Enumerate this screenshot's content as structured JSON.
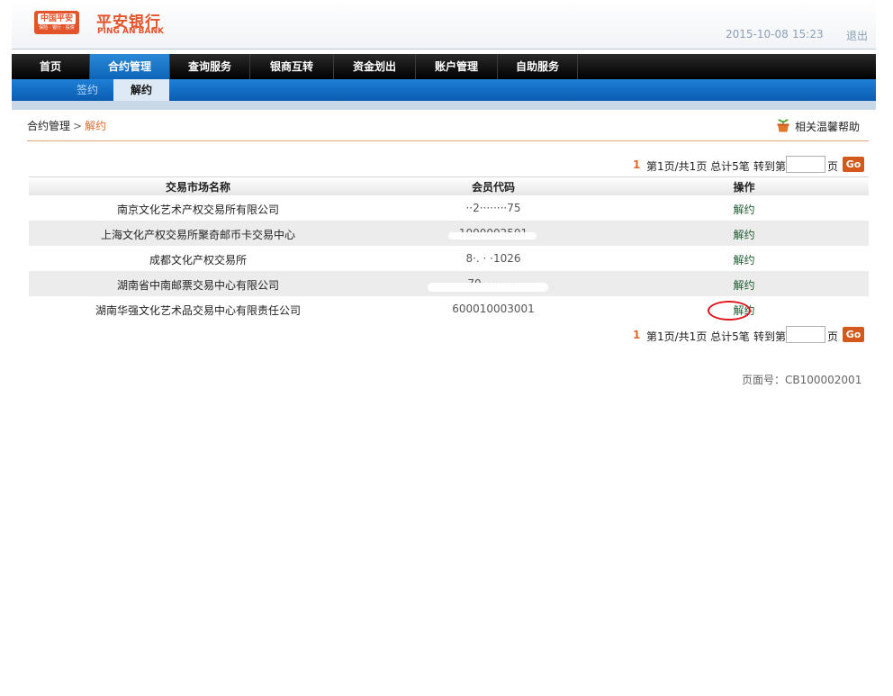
{
  "header": {
    "logo_cn": "平安银行",
    "logo_en": "PING AN BANK",
    "logo_badge": "中国平安",
    "logo_badge_sub": "保险 · 银行 · 投资",
    "date": "2015-10-08",
    "time": "15:23",
    "logout": "退出"
  },
  "nav": {
    "items": [
      {
        "label": "首页"
      },
      {
        "label": "合约管理",
        "active": true
      },
      {
        "label": "查询服务"
      },
      {
        "label": "银商互转"
      },
      {
        "label": "资金划出"
      },
      {
        "label": "账户管理"
      },
      {
        "label": "自助服务"
      }
    ]
  },
  "subnav": {
    "items": [
      {
        "label": "签约"
      },
      {
        "label": "解约",
        "active": true
      }
    ]
  },
  "breadcrumb": {
    "parent": "合约管理",
    "separator": ">",
    "current": "解约"
  },
  "help": {
    "label": "相关温馨帮助",
    "icon": "plant-pot-icon"
  },
  "pager": {
    "current": "1",
    "info": "第1页/共1页 总计5笔",
    "goto_label": "转到第",
    "page_suffix": "页",
    "go_label": "Go",
    "input_value": ""
  },
  "table": {
    "headers": [
      "交易市场名称",
      "会员代码",
      "操作"
    ],
    "rows": [
      {
        "name": "南京文化艺术产权交易所有限公司",
        "code": "··2········75",
        "action": "解约"
      },
      {
        "name": "上海文化产权交易所聚奇邮币卡交易中心",
        "code": "1000002501",
        "action": "解约"
      },
      {
        "name": "成都文化产权交易所",
        "code": "8·.  · ·1026",
        "action": "解约"
      },
      {
        "name": "湖南省中南邮票交易中心有限公司",
        "code": "70·   ·········",
        "action": "解约"
      },
      {
        "name": "湖南华强文化艺术品交易中心有限责任公司",
        "code": "600010003001",
        "action": "解约"
      }
    ]
  },
  "footer": {
    "page_no": "页面号：CB100002001"
  },
  "colors": {
    "accent_orange": "#e4542a",
    "nav_active_blue": "#0d64b8",
    "highlight_circle": "#e0141c"
  }
}
